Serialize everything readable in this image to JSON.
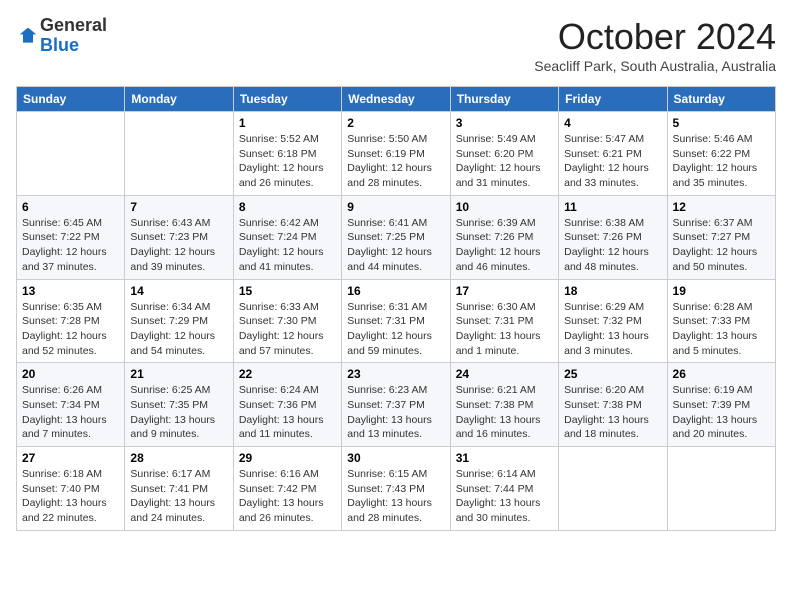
{
  "header": {
    "logo_general": "General",
    "logo_blue": "Blue",
    "month_year": "October 2024",
    "location": "Seacliff Park, South Australia, Australia"
  },
  "weekdays": [
    "Sunday",
    "Monday",
    "Tuesday",
    "Wednesday",
    "Thursday",
    "Friday",
    "Saturday"
  ],
  "weeks": [
    [
      {
        "day": "",
        "detail": ""
      },
      {
        "day": "",
        "detail": ""
      },
      {
        "day": "1",
        "detail": "Sunrise: 5:52 AM\nSunset: 6:18 PM\nDaylight: 12 hours and 26 minutes."
      },
      {
        "day": "2",
        "detail": "Sunrise: 5:50 AM\nSunset: 6:19 PM\nDaylight: 12 hours and 28 minutes."
      },
      {
        "day": "3",
        "detail": "Sunrise: 5:49 AM\nSunset: 6:20 PM\nDaylight: 12 hours and 31 minutes."
      },
      {
        "day": "4",
        "detail": "Sunrise: 5:47 AM\nSunset: 6:21 PM\nDaylight: 12 hours and 33 minutes."
      },
      {
        "day": "5",
        "detail": "Sunrise: 5:46 AM\nSunset: 6:22 PM\nDaylight: 12 hours and 35 minutes."
      }
    ],
    [
      {
        "day": "6",
        "detail": "Sunrise: 6:45 AM\nSunset: 7:22 PM\nDaylight: 12 hours and 37 minutes."
      },
      {
        "day": "7",
        "detail": "Sunrise: 6:43 AM\nSunset: 7:23 PM\nDaylight: 12 hours and 39 minutes."
      },
      {
        "day": "8",
        "detail": "Sunrise: 6:42 AM\nSunset: 7:24 PM\nDaylight: 12 hours and 41 minutes."
      },
      {
        "day": "9",
        "detail": "Sunrise: 6:41 AM\nSunset: 7:25 PM\nDaylight: 12 hours and 44 minutes."
      },
      {
        "day": "10",
        "detail": "Sunrise: 6:39 AM\nSunset: 7:26 PM\nDaylight: 12 hours and 46 minutes."
      },
      {
        "day": "11",
        "detail": "Sunrise: 6:38 AM\nSunset: 7:26 PM\nDaylight: 12 hours and 48 minutes."
      },
      {
        "day": "12",
        "detail": "Sunrise: 6:37 AM\nSunset: 7:27 PM\nDaylight: 12 hours and 50 minutes."
      }
    ],
    [
      {
        "day": "13",
        "detail": "Sunrise: 6:35 AM\nSunset: 7:28 PM\nDaylight: 12 hours and 52 minutes."
      },
      {
        "day": "14",
        "detail": "Sunrise: 6:34 AM\nSunset: 7:29 PM\nDaylight: 12 hours and 54 minutes."
      },
      {
        "day": "15",
        "detail": "Sunrise: 6:33 AM\nSunset: 7:30 PM\nDaylight: 12 hours and 57 minutes."
      },
      {
        "day": "16",
        "detail": "Sunrise: 6:31 AM\nSunset: 7:31 PM\nDaylight: 12 hours and 59 minutes."
      },
      {
        "day": "17",
        "detail": "Sunrise: 6:30 AM\nSunset: 7:31 PM\nDaylight: 13 hours and 1 minute."
      },
      {
        "day": "18",
        "detail": "Sunrise: 6:29 AM\nSunset: 7:32 PM\nDaylight: 13 hours and 3 minutes."
      },
      {
        "day": "19",
        "detail": "Sunrise: 6:28 AM\nSunset: 7:33 PM\nDaylight: 13 hours and 5 minutes."
      }
    ],
    [
      {
        "day": "20",
        "detail": "Sunrise: 6:26 AM\nSunset: 7:34 PM\nDaylight: 13 hours and 7 minutes."
      },
      {
        "day": "21",
        "detail": "Sunrise: 6:25 AM\nSunset: 7:35 PM\nDaylight: 13 hours and 9 minutes."
      },
      {
        "day": "22",
        "detail": "Sunrise: 6:24 AM\nSunset: 7:36 PM\nDaylight: 13 hours and 11 minutes."
      },
      {
        "day": "23",
        "detail": "Sunrise: 6:23 AM\nSunset: 7:37 PM\nDaylight: 13 hours and 13 minutes."
      },
      {
        "day": "24",
        "detail": "Sunrise: 6:21 AM\nSunset: 7:38 PM\nDaylight: 13 hours and 16 minutes."
      },
      {
        "day": "25",
        "detail": "Sunrise: 6:20 AM\nSunset: 7:38 PM\nDaylight: 13 hours and 18 minutes."
      },
      {
        "day": "26",
        "detail": "Sunrise: 6:19 AM\nSunset: 7:39 PM\nDaylight: 13 hours and 20 minutes."
      }
    ],
    [
      {
        "day": "27",
        "detail": "Sunrise: 6:18 AM\nSunset: 7:40 PM\nDaylight: 13 hours and 22 minutes."
      },
      {
        "day": "28",
        "detail": "Sunrise: 6:17 AM\nSunset: 7:41 PM\nDaylight: 13 hours and 24 minutes."
      },
      {
        "day": "29",
        "detail": "Sunrise: 6:16 AM\nSunset: 7:42 PM\nDaylight: 13 hours and 26 minutes."
      },
      {
        "day": "30",
        "detail": "Sunrise: 6:15 AM\nSunset: 7:43 PM\nDaylight: 13 hours and 28 minutes."
      },
      {
        "day": "31",
        "detail": "Sunrise: 6:14 AM\nSunset: 7:44 PM\nDaylight: 13 hours and 30 minutes."
      },
      {
        "day": "",
        "detail": ""
      },
      {
        "day": "",
        "detail": ""
      }
    ]
  ]
}
